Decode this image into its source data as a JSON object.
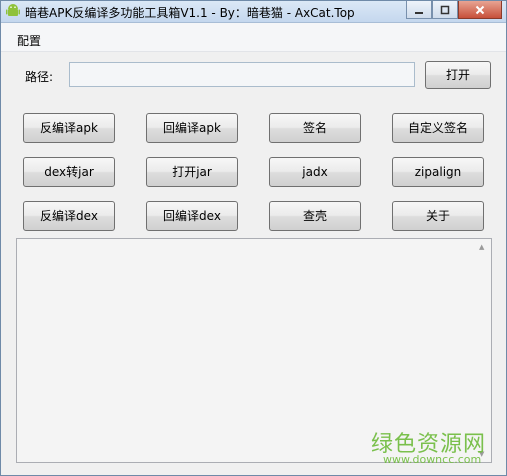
{
  "window": {
    "title": "暗巷APK反编译多功能工具箱V1.1 - By：暗巷猫 - AxCat.Top",
    "controls": {
      "close": "x"
    }
  },
  "menu": {
    "config": "配置"
  },
  "path": {
    "label": "路径:",
    "value": "",
    "open_button": "打开"
  },
  "buttons": {
    "row1": [
      "反编译apk",
      "回编译apk",
      "签名",
      "自定义签名"
    ],
    "row2": [
      "dex转jar",
      "打开jar",
      "jadx",
      "zipalign"
    ],
    "row3": [
      "反编译dex",
      "回编译dex",
      "查壳",
      "关于"
    ]
  },
  "output": {
    "text": ""
  },
  "watermark": {
    "brand": "绿色资源网",
    "url": "www.downcc.com"
  },
  "colors": {
    "watermark": "#6dbb3a",
    "titlebar": "#c4d7ee"
  }
}
